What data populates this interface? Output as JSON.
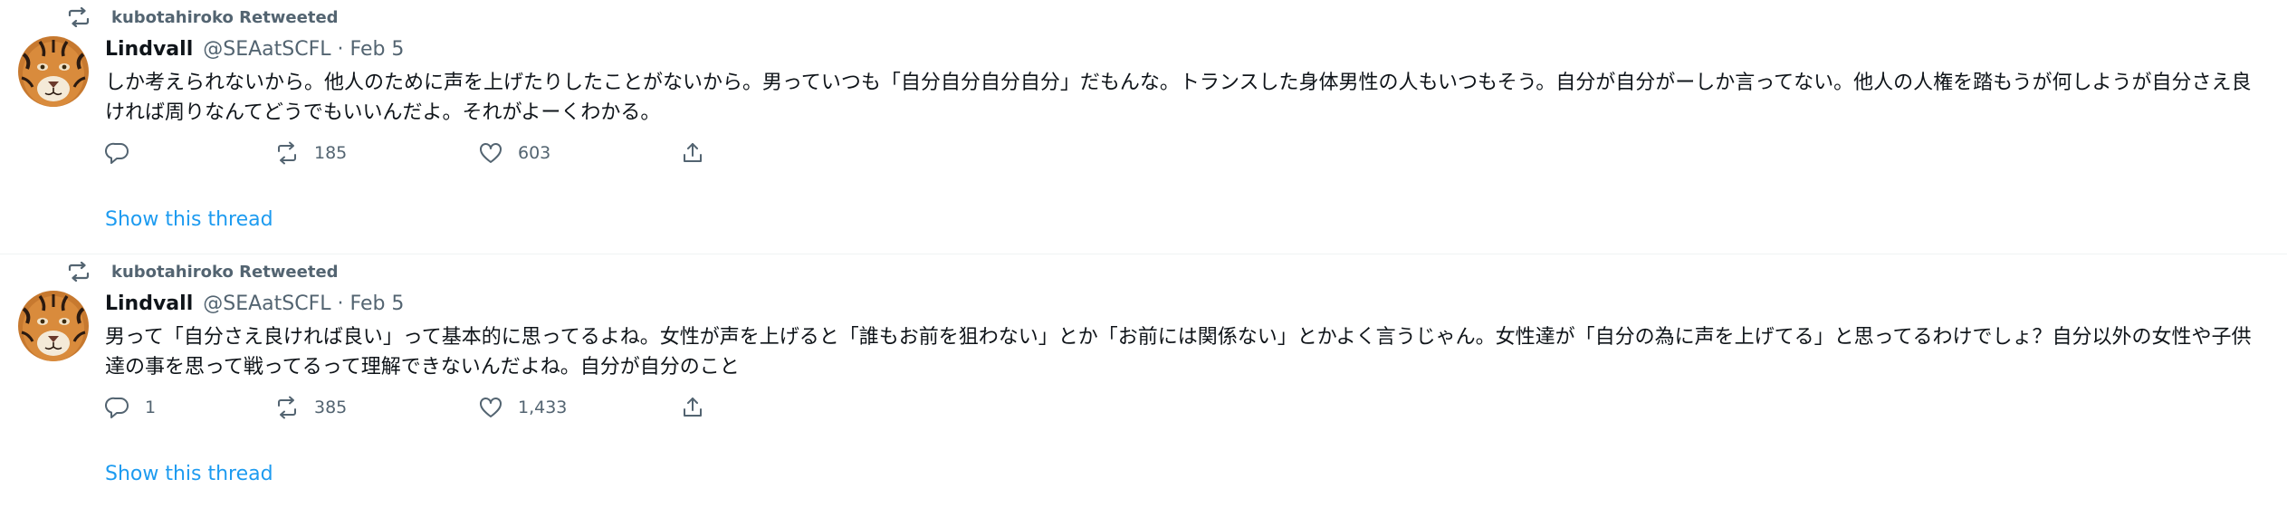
{
  "tweets": [
    {
      "retweeted_by": "kubotahiroko Retweeted",
      "author_name": "Lindvall",
      "author_meta": "@SEAatSCFL · Feb 5",
      "text": "しか考えられないから。他人のために声を上げたりしたことがないから。男っていつも「自分自分自分自分」だもんな。トランスした身体男性の人もいつもそう。自分が自分がーしか言ってない。他人の人権を踏もうが何しようが自分さえ良ければ周りなんてどうでもいいんだよ。それがよーくわかる。",
      "reply_count": "",
      "retweet_count": "185",
      "like_count": "603",
      "show_thread": "Show this thread"
    },
    {
      "retweeted_by": "kubotahiroko Retweeted",
      "author_name": "Lindvall",
      "author_meta": "@SEAatSCFL · Feb 5",
      "text": "男って「自分さえ良ければ良い」って基本的に思ってるよね。女性が声を上げると「誰もお前を狙わない」とか「お前には関係ない」とかよく言うじゃん。女性達が「自分の為に声を上げてる」と思ってるわけでしょ？自分以外の女性や子供達の事を思って戦ってるって理解できないんだよね。自分が自分のこと",
      "reply_count": "1",
      "retweet_count": "385",
      "like_count": "1,433",
      "show_thread": "Show this thread"
    }
  ],
  "icons": {
    "retweet": "retweet-icon",
    "reply": "reply-icon",
    "like": "heart-icon",
    "share": "share-icon",
    "avatar": "tiger-avatar"
  },
  "colors": {
    "link": "#1d9bf0",
    "muted": "#536471",
    "text": "#0f1419"
  }
}
